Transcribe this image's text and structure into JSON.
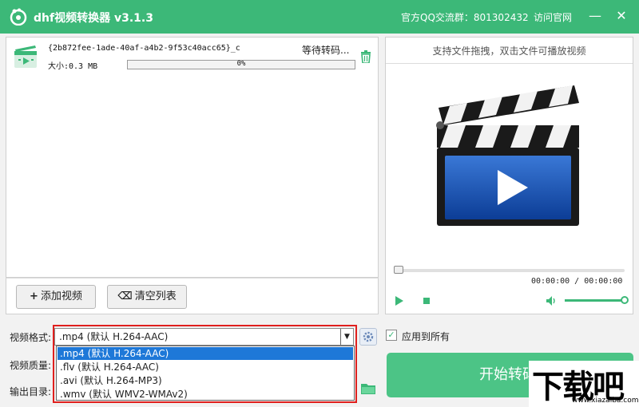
{
  "app": {
    "title": "dhf视频转换器 v3.1.3",
    "qq_group": "官方QQ交流群：801302432",
    "visit_site": "访问官网",
    "minimize": "—",
    "close": "✕"
  },
  "file_list": {
    "items": [
      {
        "name": "{2b872fee-1ade-40af-a4b2-9f53c40acc65}_c",
        "status": "等待转码...",
        "size": "大小:0.3 MB",
        "progress_text": "0%",
        "progress": 0
      }
    ],
    "add_button": "添加视频",
    "clear_button": "清空列表"
  },
  "preview": {
    "hint": "支持文件拖拽，双击文件可播放视频",
    "time": "00:00:00 / 00:00:00",
    "volume": 1.0
  },
  "settings": {
    "format_label": "视频格式:",
    "format_value": ".mp4 (默认 H.264-AAC)",
    "quality_label": "视频质量:",
    "output_label": "输出目录:",
    "apply_all_label": "应用到所有",
    "apply_all_checked": true,
    "format_options": [
      ".mp4 (默认 H.264-AAC)",
      ".flv (默认 H.264-AAC)",
      ".avi (默认 H.264-MP3)",
      ".wmv (默认 WMV2-WMAv2)"
    ]
  },
  "convert_button": "开始转码",
  "watermark": {
    "text": "下载吧",
    "url": "www.xiazaiba.com"
  },
  "colors": {
    "brand": "#3cb878",
    "selection": "#1e78d8",
    "highlight": "#e0201e"
  }
}
